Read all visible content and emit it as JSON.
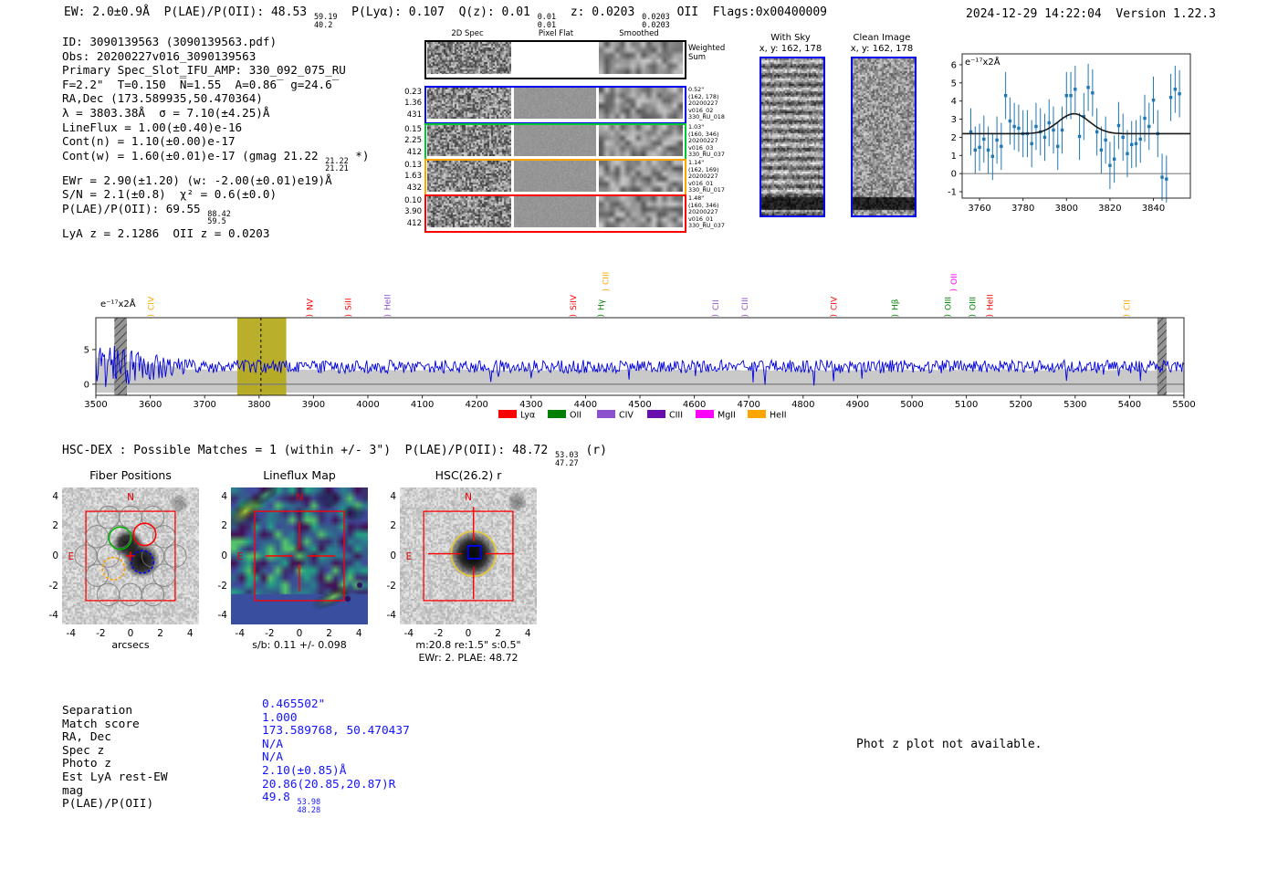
{
  "header": {
    "left_segments": [
      {
        "t": "EW: 2.0±0.9Å  P(LAE)/P(OII): 48.53 "
      },
      {
        "sup": "59.19",
        "sub": "40.2"
      },
      {
        "t": "  P(Lyα): 0.107  Q(z): 0.01 "
      },
      {
        "sup": "0.01",
        "sub": "0.01"
      },
      {
        "t": "  z: 0.0203 "
      },
      {
        "sup": "0.0203",
        "sub": "0.0203"
      },
      {
        "t": " OII  Flags:0x00400009"
      }
    ],
    "datetime": "2024-12-29 14:22:04",
    "version": "Version 1.22.3"
  },
  "info_lines": [
    [
      {
        "t": "ID: 3090139563 (3090139563.pdf)"
      }
    ],
    [
      {
        "t": "Obs: 20200227v016_3090139563"
      }
    ],
    [
      {
        "t": "Primary Spec_Slot_IFU_AMP: 330_092_075_RU"
      }
    ],
    [
      {
        "t": "F=2.2\"  T=0.150  N̅=1.55  A=0.86̅  g=24.6̅"
      }
    ],
    [
      {
        "t": "RA,Dec (173.589935,50.470364)"
      }
    ],
    [
      {
        "t": "λ = 3803.38Å  σ = 7.10(±4.25)Å"
      }
    ],
    [
      {
        "t": "LineFlux = 1.00(±0.40)e-16"
      }
    ],
    [
      {
        "t": "Cont(n) = 1.10(±0.00)e-17"
      }
    ],
    [
      {
        "t": "Cont(w) = 1.60(±0.01)e-17 (gmag 21.22 "
      },
      {
        "sup": "21.22",
        "sub": "21.21"
      },
      {
        "t": " *)"
      }
    ],
    [
      {
        "t": "EWr = 2.90(±1.20) (w: -2.00(±0.01)e19)Å"
      }
    ],
    [
      {
        "t": "S/N = 2.1(±0.8)  χ² = 0.6(±0.0)"
      }
    ],
    [
      {
        "t": "P(LAE)/P(OII): 69.55 "
      },
      {
        "sup": "88.42",
        "sub": "59.5"
      }
    ],
    [
      {
        "t": "LyA z = 2.1286  OII z = 0.0203"
      }
    ]
  ],
  "cutouts_2d": {
    "col_headers": [
      "2D Spec",
      "Pixel Flat",
      "Smoothed"
    ],
    "weighted_sum_label": "Weighted\nSum",
    "rows": [
      {
        "border": "#000000",
        "left": [],
        "right": [],
        "flat_white": true
      },
      {
        "border": "#0000ee",
        "left": [
          "0.23",
          "1.36",
          "431"
        ],
        "right": [
          "0.52\"",
          "(162, 178)",
          "20200227",
          "v016_02",
          "330_RU_018"
        ]
      },
      {
        "border": "#00c832",
        "left": [
          "0.15",
          "2.25",
          "412"
        ],
        "right": [
          "1.03\"",
          "(160, 346)",
          "20200227",
          "v016_03",
          "330_RU_037"
        ]
      },
      {
        "border": "#ffa500",
        "left": [
          "0.13",
          "1.63",
          "432"
        ],
        "right": [
          "1.14\"",
          "(162, 169)",
          "20200227",
          "v016_01",
          "330_RU_017"
        ]
      },
      {
        "border": "#ff0000",
        "left": [
          "0.10",
          "3.90",
          "412"
        ],
        "right": [
          "1.48\"",
          "(160, 346)",
          "20200227",
          "v016_01",
          "330_RU_037"
        ]
      }
    ]
  },
  "sky_panels": [
    {
      "title": "With Sky",
      "subtitle": "x, y: 162, 178",
      "style": "striped"
    },
    {
      "title": "Clean Image",
      "subtitle": "x, y: 162, 178",
      "style": "noise"
    }
  ],
  "hsc_dex_segments": [
    {
      "t": "HSC-DEX : Possible Matches = 1 (within +/- 3\")  P(LAE)/P(OII): 48.72 "
    },
    {
      "sup": "53.03",
      "sub": "47.27"
    },
    {
      "t": " (r)"
    }
  ],
  "match_panels": {
    "fiber": {
      "title": "Fiber Positions",
      "xlabel": "arcsecs",
      "north": "N",
      "east": "E",
      "xticks": [
        "-4",
        "-2",
        "0",
        "2",
        "4"
      ],
      "yticks": [
        "4",
        "2",
        "0",
        "-2",
        "-4"
      ]
    },
    "lineflux": {
      "title": "Lineflux Map",
      "xlabel": "s/b: 0.11 +/- 0.098",
      "north": "N",
      "east": "E",
      "xticks": [
        "-4",
        "-2",
        "0",
        "2",
        "4"
      ],
      "yticks": [
        "4",
        "2",
        "0",
        "-2",
        "-4"
      ]
    },
    "hsc": {
      "title": "HSC(26.2) r",
      "xlabel": "m:20.8  re:1.5\"  s:0.5\"",
      "xlabel2": "EWr: 2. PLAE: 48.72",
      "north": "N",
      "east": "E",
      "xticks": [
        "-4",
        "-2",
        "0",
        "2",
        "4"
      ],
      "yticks": [
        "4",
        "2",
        "0",
        "-2",
        "-4"
      ]
    }
  },
  "match_table": {
    "rows": [
      {
        "label": "Separation",
        "segments": [
          {
            "t": "0.465502\""
          }
        ]
      },
      {
        "label": "Match score",
        "segments": [
          {
            "t": "1.000"
          }
        ]
      },
      {
        "label": "RA, Dec",
        "segments": [
          {
            "t": "173.589768, 50.470437"
          }
        ]
      },
      {
        "label": "Spec z",
        "segments": [
          {
            "t": "N/A"
          }
        ]
      },
      {
        "label": "Photo z",
        "segments": [
          {
            "t": "N/A"
          }
        ]
      },
      {
        "label": "Est LyA rest-EW",
        "segments": [
          {
            "t": "2.10(±0.85)Å"
          }
        ]
      },
      {
        "label": "mag",
        "segments": [
          {
            "t": "20.86(20.85,20.87)R"
          }
        ]
      },
      {
        "label": "P(LAE)/P(OII)",
        "segments": [
          {
            "t": "49.8 "
          },
          {
            "sup": "53.98",
            "sub": "48.28"
          }
        ]
      }
    ]
  },
  "photz_note": "Phot z plot not available.",
  "colors": {
    "value_blue": "#1414ff",
    "spectrum_blue": "#0000dd",
    "point_blue": "#1f77b4",
    "highlight_olive": "#b3a818",
    "error_band_gray": "#c9c9c9",
    "box_red": "#ff0000",
    "yellow_aperture": "#e6c832"
  },
  "chart_data": [
    {
      "id": "line_fit_inset",
      "type": "scatter",
      "title": "",
      "xlabel": "",
      "ylabel": "e⁻¹⁷x2Å",
      "x": [
        3756,
        3758,
        3760,
        3762,
        3764,
        3766,
        3768,
        3770,
        3772,
        3774,
        3776,
        3778,
        3780,
        3782,
        3784,
        3786,
        3788,
        3790,
        3792,
        3794,
        3796,
        3798,
        3800,
        3802,
        3804,
        3806,
        3808,
        3810,
        3812,
        3814,
        3816,
        3818,
        3820,
        3822,
        3824,
        3826,
        3828,
        3830,
        3832,
        3834,
        3836,
        3838,
        3840,
        3842,
        3844,
        3846,
        3848,
        3850,
        3852
      ],
      "y": [
        2.3,
        1.3,
        1.45,
        1.9,
        1.3,
        0.95,
        1.85,
        1.5,
        4.3,
        2.9,
        2.6,
        2.5,
        2.2,
        2.2,
        1.65,
        2.6,
        2.3,
        2.0,
        2.8,
        2.4,
        1.5,
        2.4,
        4.3,
        4.3,
        4.65,
        2.05,
        3.15,
        4.75,
        4.45,
        2.3,
        1.3,
        1.85,
        0.45,
        0.8,
        2.65,
        2.0,
        1.1,
        1.6,
        1.65,
        1.9,
        3.05,
        2.6,
        4.05,
        2.2,
        -0.2,
        -0.3,
        4.2,
        4.65,
        4.4
      ],
      "yerr": 1.3,
      "fit_curve": {
        "shape": "gaussian_plus_constant",
        "continuum": 2.2,
        "amplitude": 1.1,
        "center": 3803.4,
        "sigma": 7.1
      },
      "xlim": [
        3752,
        3857
      ],
      "ylim": [
        -1.35,
        6.6
      ],
      "xticks": [
        3760,
        3780,
        3800,
        3820,
        3840
      ],
      "yticks": [
        -1,
        0,
        1,
        2,
        3,
        4,
        5,
        6
      ],
      "grid": false,
      "legend_position": "none"
    },
    {
      "id": "full_spectrum",
      "type": "line",
      "ylabel": "e⁻¹⁷x2Å",
      "xlim": [
        3500,
        5500
      ],
      "ylim": [
        -1.6,
        9.6
      ],
      "xticks": [
        3500,
        3600,
        3700,
        3800,
        3900,
        4000,
        4100,
        4200,
        4300,
        4400,
        4500,
        4600,
        4700,
        4800,
        4900,
        5000,
        5100,
        5200,
        5300,
        5400,
        5500
      ],
      "yticks": [
        0,
        5
      ],
      "baseline": 2.55,
      "noise_sigma": 0.95,
      "left_noise_boost_until": 3680,
      "error_band": {
        "bottom": -1.25,
        "top": 2.05
      },
      "emission_highlight": {
        "from": 3760,
        "to": 3850,
        "center_dashed_line": 3803.38
      },
      "masked_bands": [
        [
          3534,
          3557
        ],
        [
          5451,
          5468
        ]
      ],
      "marker_suffix": "(",
      "line_markers": [
        {
          "label": "CIV",
          "wavelength": 3601,
          "color": "#ffa500",
          "high": false
        },
        {
          "label": "NV",
          "wavelength": 3893,
          "color": "#ff0000",
          "high": false
        },
        {
          "label": "SiII",
          "wavelength": 3964,
          "color": "#ff0000",
          "high": false
        },
        {
          "label": "HeII",
          "wavelength": 4036,
          "color": "#8c51cc",
          "high": false
        },
        {
          "label": "SiIV",
          "wavelength": 4377,
          "color": "#ff0000",
          "high": false
        },
        {
          "label": "Hγ",
          "wavelength": 4428,
          "color": "#008000",
          "high": false
        },
        {
          "label": "CIII",
          "wavelength": 4437,
          "color": "#ffa500",
          "high": true
        },
        {
          "label": "CII",
          "wavelength": 4639,
          "color": "#8c51cc",
          "high": false
        },
        {
          "label": "CIII",
          "wavelength": 4693,
          "color": "#8c51cc",
          "high": false
        },
        {
          "label": "CIV",
          "wavelength": 4856,
          "color": "#ff0000",
          "high": false
        },
        {
          "label": "Hβ",
          "wavelength": 4969,
          "color": "#008000",
          "high": false
        },
        {
          "label": "OIII",
          "wavelength": 5066,
          "color": "#008000",
          "high": false
        },
        {
          "label": "OII",
          "wavelength": 5077,
          "color": "#ff00ff",
          "high": true
        },
        {
          "label": "OIII",
          "wavelength": 5111,
          "color": "#008000",
          "high": false
        },
        {
          "label": "HeII",
          "wavelength": 5143,
          "color": "#ff0000",
          "high": false
        },
        {
          "label": "CII",
          "wavelength": 5395,
          "color": "#ffa500",
          "high": false
        }
      ],
      "legend": [
        {
          "label": "Lyα",
          "color": "#ff0000"
        },
        {
          "label": "OII",
          "color": "#008000"
        },
        {
          "label": "CIV",
          "color": "#8c51cc"
        },
        {
          "label": "CIII",
          "color": "#6a0dad"
        },
        {
          "label": "MgII",
          "color": "#ff00ff"
        },
        {
          "label": "HeII",
          "color": "#ffa500"
        }
      ],
      "legend_position": "bottom-center",
      "grid": false
    }
  ]
}
